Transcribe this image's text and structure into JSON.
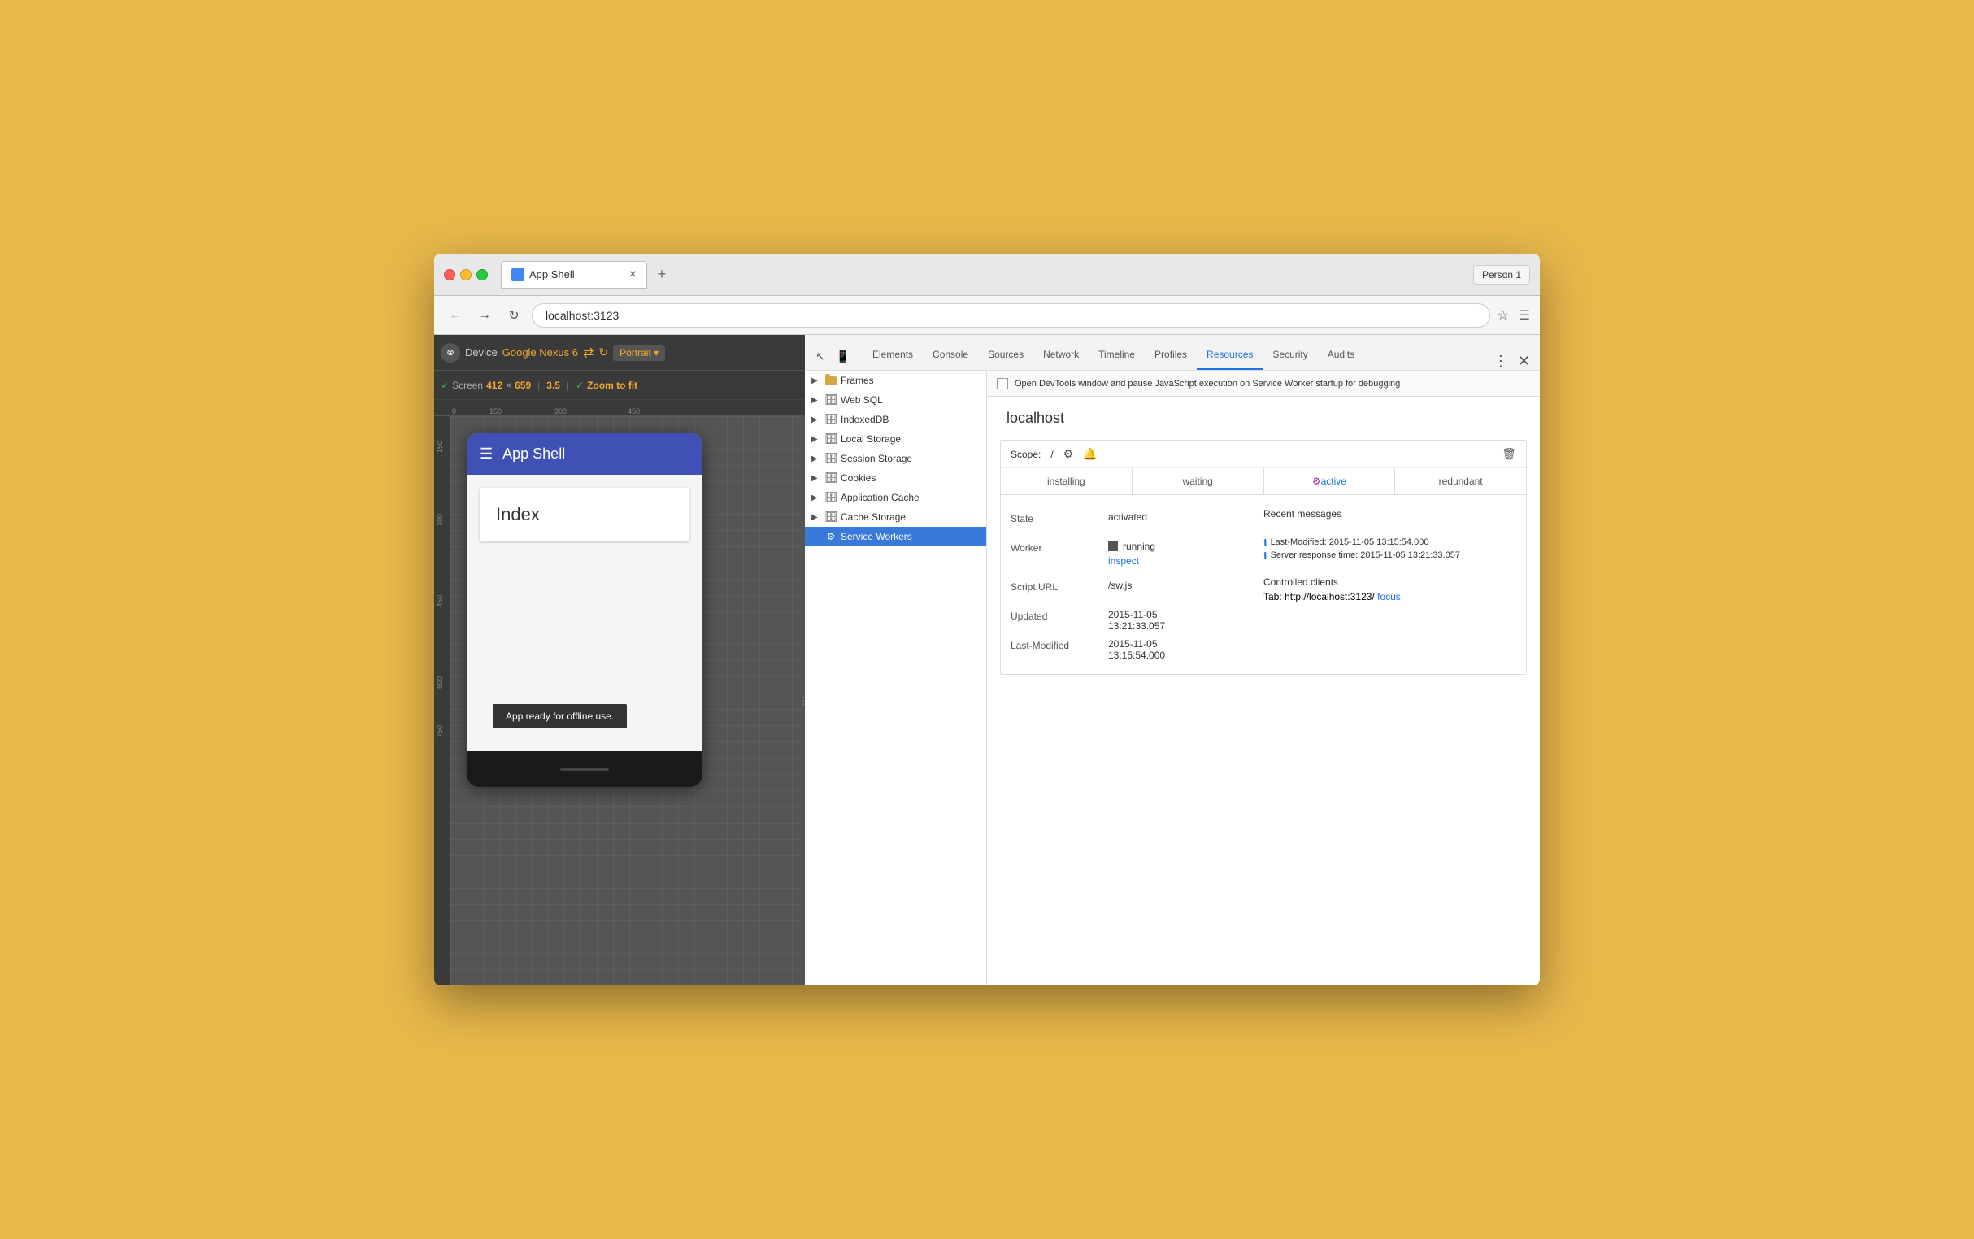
{
  "window": {
    "title": "App Shell",
    "profile": "Person 1",
    "url": "localhost:3123",
    "tab_label": "App Shell"
  },
  "devtools": {
    "tabs": [
      "Elements",
      "Console",
      "Sources",
      "Network",
      "Timeline",
      "Profiles",
      "Resources",
      "Security",
      "Audits"
    ],
    "active_tab": "Resources",
    "debug_bar_text": "Open DevTools window and pause JavaScript execution on Service Worker startup for debugging"
  },
  "device_toolbar": {
    "label": "Device",
    "device_name": "Google Nexus 6",
    "orientation": "Portrait ▾",
    "screen_label": "Screen",
    "width": "412",
    "x": "×",
    "height": "659",
    "dpr": "3.5",
    "zoom_label": "Zoom to fit"
  },
  "tree": {
    "items": [
      {
        "label": "Frames",
        "type": "folder",
        "indent": 0,
        "has_arrow": true
      },
      {
        "label": "Web SQL",
        "type": "db",
        "indent": 0,
        "has_arrow": true
      },
      {
        "label": "IndexedDB",
        "type": "db",
        "indent": 0,
        "has_arrow": true
      },
      {
        "label": "Local Storage",
        "type": "db",
        "indent": 0,
        "has_arrow": true
      },
      {
        "label": "Session Storage",
        "type": "db",
        "indent": 0,
        "has_arrow": true
      },
      {
        "label": "Cookies",
        "type": "db",
        "indent": 0,
        "has_arrow": true
      },
      {
        "label": "Application Cache",
        "type": "db",
        "indent": 0,
        "has_arrow": true
      },
      {
        "label": "Cache Storage",
        "type": "db",
        "indent": 0,
        "has_arrow": true
      },
      {
        "label": "Service Workers",
        "type": "sw",
        "indent": 0,
        "has_arrow": false,
        "selected": true
      }
    ]
  },
  "sw": {
    "host": "localhost",
    "scope_label": "Scope:",
    "scope_value": "/",
    "status_tabs": [
      "installing",
      "waiting",
      "active",
      "redundant"
    ],
    "active_tab": "active",
    "state_label": "State",
    "state_value": "activated",
    "worker_label": "Worker",
    "worker_running": "running",
    "worker_inspect": "inspect",
    "recent_messages_label": "Recent messages",
    "message1": "Last-Modified: 2015-11-05 13:15:54.000",
    "message2": "Server response time: 2015-11-05 13:21:33.057",
    "controlled_label": "Controlled clients",
    "client_tab": "Tab: http://localhost:3123/",
    "client_focus": "focus",
    "script_url_label": "Script URL",
    "script_url_value": "/sw.js",
    "updated_label": "Updated",
    "updated_value": "2015-11-05\n13:21:33.057",
    "last_modified_label": "Last-Modified",
    "last_modified_value": "2015-11-05\n13:15:54.000"
  },
  "app": {
    "title": "App Shell",
    "content_title": "Index",
    "toast": "App ready for offline use."
  }
}
